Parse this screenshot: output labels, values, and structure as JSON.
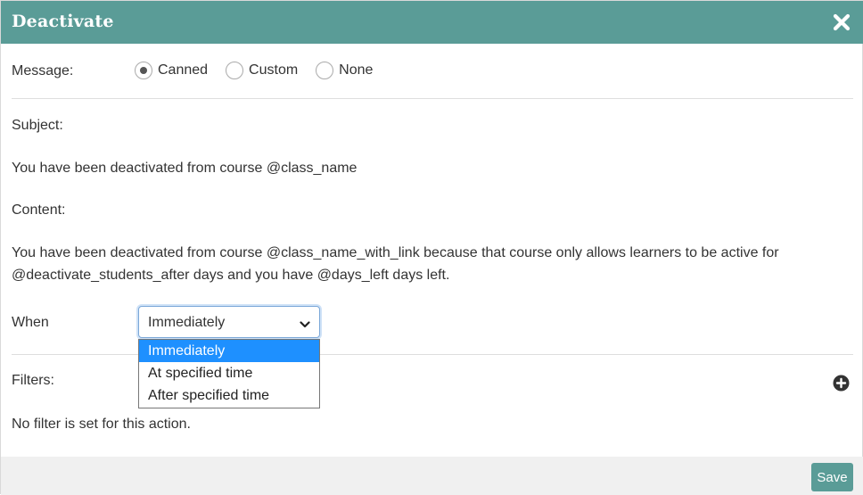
{
  "dialog": {
    "title": "Deactivate"
  },
  "message": {
    "label": "Message:",
    "options": [
      "Canned",
      "Custom",
      "None"
    ],
    "selected": "Canned"
  },
  "subject": {
    "label": "Subject:",
    "text": "You have been deactivated from course @class_name"
  },
  "content": {
    "label": "Content:",
    "text": "You have been deactivated from course @class_name_with_link because that course only allows learners to be active for @deactivate_students_after days and you have @days_left days left."
  },
  "when": {
    "label": "When",
    "value": "Immediately",
    "options": [
      "Immediately",
      "At specified time",
      "After specified time"
    ]
  },
  "filters": {
    "label": "Filters:",
    "empty_text": "No filter is set for this action."
  },
  "footer": {
    "save_label": "Save"
  },
  "colors": {
    "header": "#5a9c97",
    "accent_selected": "#1e90ff",
    "footer_bg": "#f0f0f0"
  },
  "icons": {
    "close": "close-icon",
    "add_filter": "plus-circle-icon",
    "dropdown": "chevron-down-icon"
  }
}
